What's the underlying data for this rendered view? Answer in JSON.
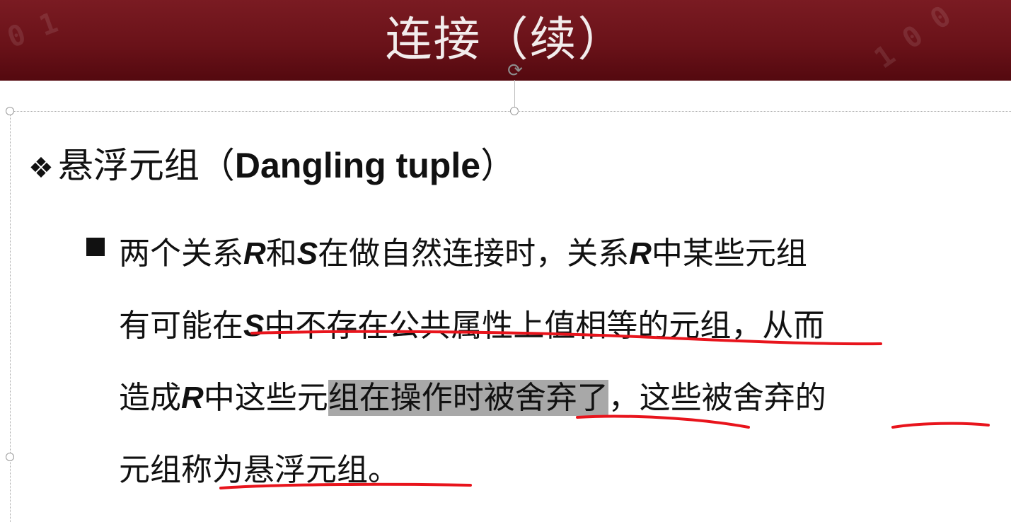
{
  "slide": {
    "title": "连接（续）",
    "heading": {
      "marker": "❖",
      "cn": "悬浮元组（",
      "en": "Dangling tuple",
      "close": "）"
    },
    "paragraph": {
      "l1a": "两个关系",
      "l1R": "R",
      "l1b": "和",
      "l1S": "S",
      "l1c": "在做自然连接时，关系",
      "l1R2": "R",
      "l1d": "中某些元组",
      "l2a": "有可能在",
      "l2S": "S",
      "l2b": "中不存在公共属性上值相等的元组，从而",
      "l3a": "造成",
      "l3R": "R",
      "l3b": "中这些元",
      "l3hl": "组在操作时被舍弃了",
      "l3c": "，这些被舍弃的",
      "l4": "元组称为悬浮元组。"
    }
  },
  "annotations": {
    "underline_color": "#e8141c",
    "highlight_color": "#a8a8a8"
  },
  "icons": {
    "rotate_handle": "rotate-icon",
    "bullet": "square-bullet-icon"
  }
}
